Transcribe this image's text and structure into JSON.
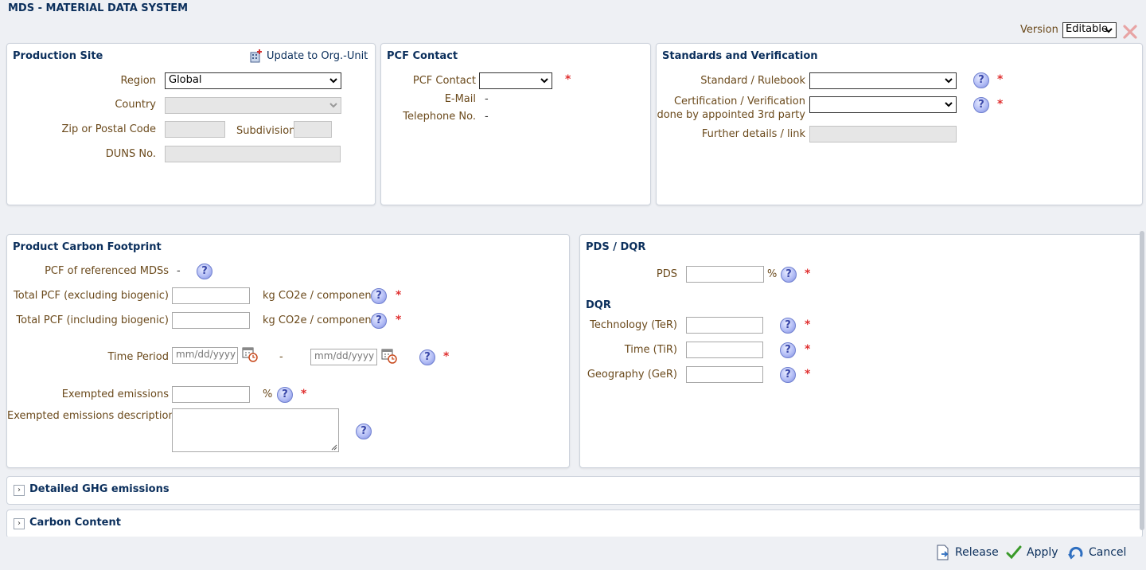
{
  "app": {
    "title": "MDS - MATERIAL DATA SYSTEM"
  },
  "version": {
    "label": "Version",
    "value": "Editable"
  },
  "production_site": {
    "title": "Production Site",
    "update_link": "Update to Org.-Unit",
    "region_label": "Region",
    "region_value": "Global",
    "country_label": "Country",
    "zip_label": "Zip or Postal Code",
    "subdivision_label": "Subdivision",
    "duns_label": "DUNS No."
  },
  "pcf_contact": {
    "title": "PCF Contact",
    "contact_label": "PCF Contact",
    "email_label": "E-Mail",
    "email_value": "-",
    "phone_label": "Telephone No.",
    "phone_value": "-"
  },
  "standards": {
    "title": "Standards and Verification",
    "rulebook_label": "Standard / Rulebook",
    "cert_label_1": "Certification / Verification",
    "cert_label_2": "done by appointed 3rd party",
    "details_label": "Further details / link"
  },
  "pcf": {
    "title": "Product Carbon Footprint",
    "referenced_label": "PCF of referenced MDSs",
    "referenced_value": "-",
    "total_excl_label": "Total PCF (excluding biogenic)",
    "total_incl_label": "Total PCF (including biogenic)",
    "unit": "kg CO2e / component",
    "time_period_label": "Time Period",
    "date_placeholder": "mm/dd/yyyy",
    "date_separator": "-",
    "exempted_label": "Exempted emissions",
    "percent": "%",
    "exempted_desc_label": "Exempted emissions description"
  },
  "pds_dqr": {
    "title": "PDS / DQR",
    "pds_label": "PDS",
    "percent": "%",
    "dqr_heading": "DQR",
    "ter_label": "Technology (TeR)",
    "tir_label": "Time (TiR)",
    "ger_label": "Geography (GeR)"
  },
  "sections": {
    "ghg": "Detailed GHG emissions",
    "carbon": "Carbon Content"
  },
  "help_glyph": "?",
  "required_mark": "*",
  "footer": {
    "release": "Release",
    "apply": "Apply",
    "cancel": "Cancel"
  },
  "colors": {
    "heading": "#0b2f5c",
    "label": "#6b4a1c",
    "required": "#e03030",
    "help": "#7d8be0"
  }
}
